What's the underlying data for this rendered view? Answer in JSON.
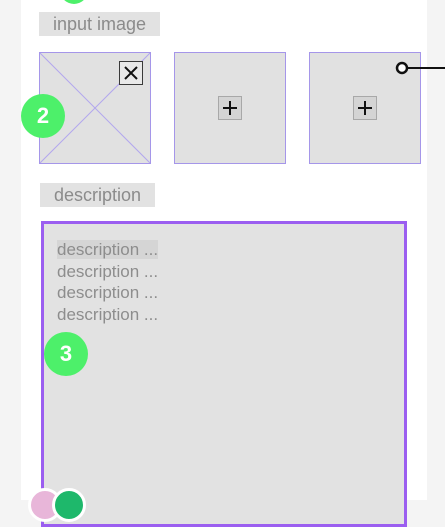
{
  "input_section": {
    "label": "input image",
    "slots": [
      {
        "state": "placeholder-image",
        "remove_icon": "close-icon"
      },
      {
        "state": "empty",
        "add_icon": "plus-icon"
      },
      {
        "state": "empty",
        "add_icon": "plus-icon"
      }
    ]
  },
  "description_section": {
    "label": "description",
    "lines": [
      "description ...",
      "description ...",
      "description ...",
      "description ..."
    ]
  },
  "badges": [
    "2",
    "3"
  ],
  "colors": {
    "accent_purple": "#9b5ef0",
    "slot_border": "#a596e9",
    "badge_green": "#4df06a",
    "avatar_pink": "#e8b6d9",
    "avatar_green": "#1eb86b"
  }
}
